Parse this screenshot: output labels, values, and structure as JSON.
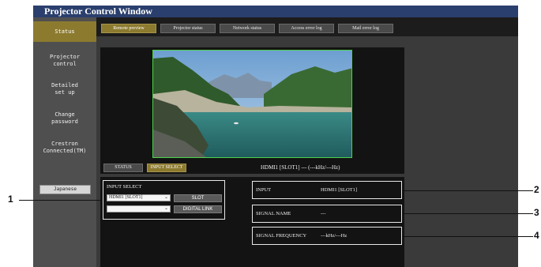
{
  "window": {
    "title": "Projector Control Window"
  },
  "sidebar": {
    "items": [
      {
        "label": "Status"
      },
      {
        "label": "Projector\ncontrol"
      },
      {
        "label": "Detailed\nset up"
      },
      {
        "label": "Change\npassword"
      },
      {
        "label": "Crestron\nConnected(TM)"
      }
    ],
    "language_button": "Japanese"
  },
  "tabs": [
    {
      "label": "Remote preview",
      "active": true
    },
    {
      "label": "Projector status",
      "active": false
    },
    {
      "label": "Network status",
      "active": false
    },
    {
      "label": "Access error log",
      "active": false
    },
    {
      "label": "Mail error log",
      "active": false
    }
  ],
  "preview": {
    "status_button": "STATUS",
    "input_select_button": "INPUT SELECT",
    "signal_summary": "HDMI1 [SLOT1] --- (---kHz/---Hz)"
  },
  "input_select": {
    "label": "INPUT SELECT",
    "select1_value": "HDMI1 [SLOT1]",
    "select2_value": "",
    "slot_button": "SLOT",
    "digital_link_button": "DIGITAL LINK"
  },
  "info": {
    "input_label": "INPUT",
    "input_value": "HDMI1 [SLOT1]",
    "signal_name_label": "SIGNAL NAME",
    "signal_name_value": "---",
    "signal_frequency_label": "SIGNAL FREQUENCY",
    "signal_frequency_value": "---kHz/---Hz"
  },
  "callouts": {
    "c1": "1",
    "c2": "2",
    "c3": "3",
    "c4": "4"
  },
  "colors": {
    "title_bar": "#2a3f6d",
    "active_accent": "#8c7a2f",
    "preview_border": "#4cd14c"
  }
}
